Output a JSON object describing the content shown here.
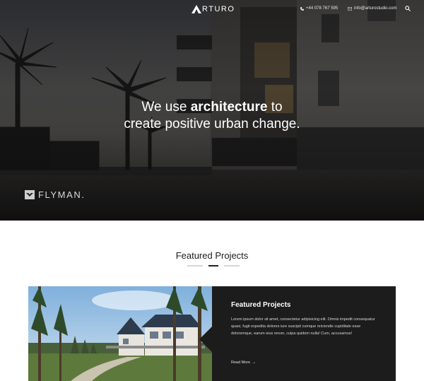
{
  "header": {
    "logo_text": "RTURO",
    "logo_icon": "arturo-logo-mark",
    "phone": "+44 078 767 595",
    "email": "info@arturostudio.com",
    "search_icon": "search-icon"
  },
  "hero": {
    "heading_prefix": "We use ",
    "heading_bold": "architecture",
    "heading_mid": " to",
    "heading_line2": "create positive urban change.",
    "watermark_text": "FLYMAN.",
    "watermark_icon": "flyman-logo-icon"
  },
  "featured": {
    "section_title": "Featured Projects",
    "slider_dots": 3,
    "active_dot": 1,
    "card": {
      "title": "Featured Projects",
      "text": "Lorem ipsum dolor sit amet, consectetur adipisicing elit. Omnis impedit consequatur quasi, fugit expedita dolores iure suscipit cumque reiciendis cupiditate esse doloremque, earum eius rerum, culpa quidem nulla! Cum, accusamus!",
      "read_more": "Read More",
      "read_more_arrow": "→"
    }
  },
  "colors": {
    "panel_bg": "#1c1c1c",
    "dot_active": "#222222",
    "dot_inactive": "#d6d6d6",
    "text_dark": "#1d1d1d"
  }
}
